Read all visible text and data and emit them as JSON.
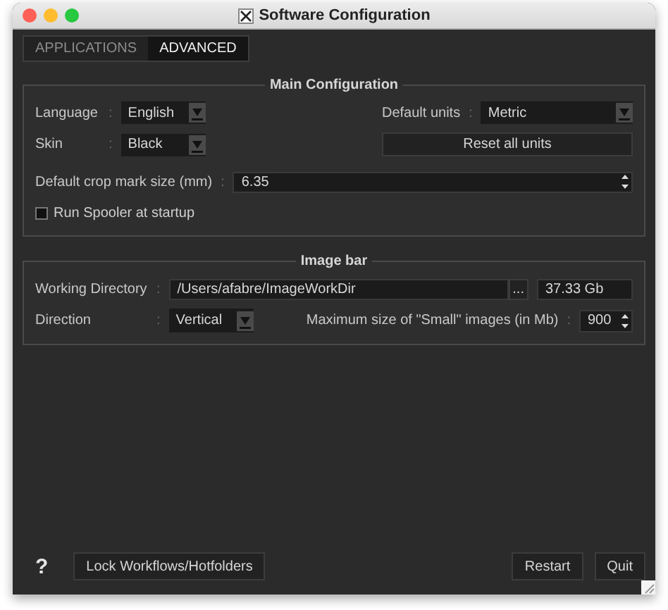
{
  "window": {
    "title": "Software Configuration"
  },
  "tabs": [
    {
      "label": "APPLICATIONS",
      "selected": false
    },
    {
      "label": "ADVANCED",
      "selected": true
    }
  ],
  "main_configuration": {
    "title": "Main Configuration",
    "language": {
      "label": "Language",
      "separator": ":",
      "value": "English"
    },
    "default_units": {
      "label": "Default units",
      "separator": ":",
      "value": "Metric"
    },
    "skin": {
      "label": "Skin",
      "separator": ":",
      "value": "Black"
    },
    "reset_button": "Reset all units",
    "crop_mark": {
      "label": "Default crop mark size (mm)",
      "separator": ":",
      "value": "6.35"
    },
    "run_spooler": {
      "label": "Run Spooler at startup",
      "checked": false
    }
  },
  "image_bar": {
    "title": "Image bar",
    "working_directory": {
      "label": "Working Directory",
      "separator": ":",
      "value": "/Users/afabre/ImageWorkDir",
      "browse": "...",
      "free_space": "37.33 Gb"
    },
    "direction": {
      "label": "Direction",
      "separator": ":",
      "value": "Vertical"
    },
    "max_small": {
      "label": "Maximum size of \"Small\" images (in Mb)",
      "separator": ":",
      "value": "900"
    }
  },
  "footer": {
    "help": "?",
    "lock_button": "Lock Workflows/Hotfolders",
    "restart_button": "Restart",
    "quit_button": "Quit"
  }
}
